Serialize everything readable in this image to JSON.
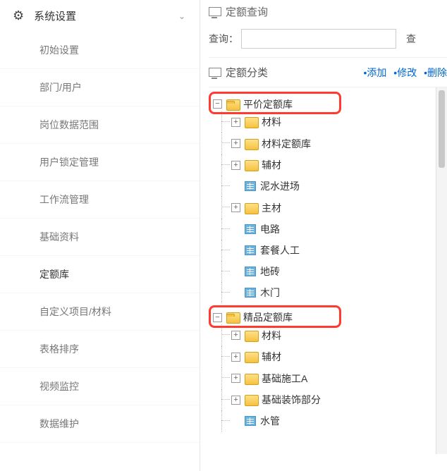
{
  "sidebar": {
    "header": "系统设置",
    "items": [
      {
        "label": "初始设置",
        "active": false
      },
      {
        "label": "部门/用户",
        "active": false
      },
      {
        "label": "岗位数据范围",
        "active": false
      },
      {
        "label": "用户锁定管理",
        "active": false
      },
      {
        "label": "工作流管理",
        "active": false
      },
      {
        "label": "基础资料",
        "active": false
      },
      {
        "label": "定额库",
        "active": true
      },
      {
        "label": "自定义项目/材料",
        "active": false
      },
      {
        "label": "表格排序",
        "active": false
      },
      {
        "label": "视频监控",
        "active": false
      },
      {
        "label": "数据维护",
        "active": false
      }
    ]
  },
  "right": {
    "query_title": "定额查询",
    "search_label": "查询：",
    "search_value": "",
    "search_btn_partial": "查",
    "category_title": "定额分类",
    "links": {
      "add": "•添加",
      "edit": "•修改",
      "delete": "•删除"
    }
  },
  "tree": [
    {
      "label": "平价定额库",
      "type": "folder",
      "expanded": true,
      "highlighted": true,
      "children": [
        {
          "label": "材料",
          "type": "folder",
          "expanded": false
        },
        {
          "label": "材料定额库",
          "type": "folder",
          "expanded": false
        },
        {
          "label": "辅材",
          "type": "folder",
          "expanded": false
        },
        {
          "label": "泥水进场",
          "type": "file"
        },
        {
          "label": "主材",
          "type": "folder",
          "expanded": false
        },
        {
          "label": "电路",
          "type": "file"
        },
        {
          "label": "套餐人工",
          "type": "file"
        },
        {
          "label": "地砖",
          "type": "file"
        },
        {
          "label": "木门",
          "type": "file",
          "partial": true
        }
      ]
    },
    {
      "label": "精品定额库",
      "type": "folder",
      "expanded": true,
      "highlighted": true,
      "children": [
        {
          "label": "材料",
          "type": "folder",
          "expanded": false
        },
        {
          "label": "辅材",
          "type": "folder",
          "expanded": false
        },
        {
          "label": "基础施工A",
          "type": "folder",
          "expanded": false
        },
        {
          "label": "基础装饰部分",
          "type": "folder",
          "expanded": false
        },
        {
          "label": "水管",
          "type": "file"
        }
      ]
    }
  ]
}
